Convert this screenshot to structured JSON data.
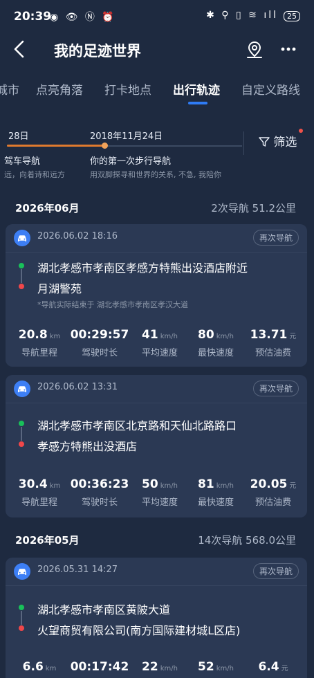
{
  "status_bar": {
    "time": "20:39",
    "left_icons": "◉ 👁 Ⓝ ⏰",
    "right_icons": "✱ ⚲ ▯ ≋ ıll",
    "battery": "25"
  },
  "header": {
    "title": "我的足迹世界",
    "back_icon": "back-arrow-icon",
    "location_icon": "map-pin-icon",
    "more_icon": "more-dots-icon"
  },
  "tabs": [
    "城市",
    "点亮角落",
    "打卡地点",
    "出行轨迹",
    "自定义路线"
  ],
  "active_tab": "出行轨迹",
  "timeline": {
    "left_date": "28日",
    "left_title": "驾车导航",
    "left_sub": "远，向着诗和远方",
    "main_date": "2018年11月24日",
    "main_title": "你的第一次步行导航",
    "main_sub": "用双脚探寻和世界的关系, 不急, 我陪你",
    "filter_label": "筛选"
  },
  "months": [
    {
      "label": "2026年06月",
      "summary": "2次导航  51.2公里"
    },
    {
      "label": "2026年05月",
      "summary": "14次导航  568.0公里"
    }
  ],
  "renav_label": "再次导航",
  "stat_labels": [
    "导航里程",
    "驾驶时长",
    "平均速度",
    "最快速度",
    "预估油费"
  ],
  "trips": [
    {
      "time": "2026.06.02 18:16",
      "from": "湖北孝感市孝南区孝感方特熊出没酒店附近",
      "to": "月湖警苑",
      "note": "*导航实际结束于 湖北孝感市孝南区孝汉大道",
      "distance": "20.8",
      "distance_unit": "km",
      "duration": "00:29:57",
      "avg_speed": "41",
      "avg_unit": "km/h",
      "max_speed": "80",
      "max_unit": "km/h",
      "fuel": "13.71",
      "fuel_unit": "元"
    },
    {
      "time": "2026.06.02 13:31",
      "from": "湖北孝感市孝南区北京路和天仙北路路口",
      "to": "孝感方特熊出没酒店",
      "note": "",
      "distance": "30.4",
      "distance_unit": "km",
      "duration": "00:36:23",
      "avg_speed": "50",
      "avg_unit": "km/h",
      "max_speed": "81",
      "max_unit": "km/h",
      "fuel": "20.05",
      "fuel_unit": "元"
    },
    {
      "time": "2026.05.31 14:27",
      "from": "湖北孝感市孝南区黄陂大道",
      "to": "火望商贸有限公司(南方国际建材城L区店)",
      "note": "",
      "distance": "6.6",
      "distance_unit": "km",
      "duration": "00:17:42",
      "avg_speed": "22",
      "avg_unit": "km/h",
      "max_speed": "52",
      "max_unit": "km/h",
      "fuel": "6.4",
      "fuel_unit": "元"
    }
  ],
  "colors": {
    "accent": "#2f7cf6",
    "timeline": "#e07a2e",
    "start_dot": "#19c15a",
    "end_dot": "#f0474a",
    "background": "#1e2a40",
    "card": "#2b3954"
  }
}
